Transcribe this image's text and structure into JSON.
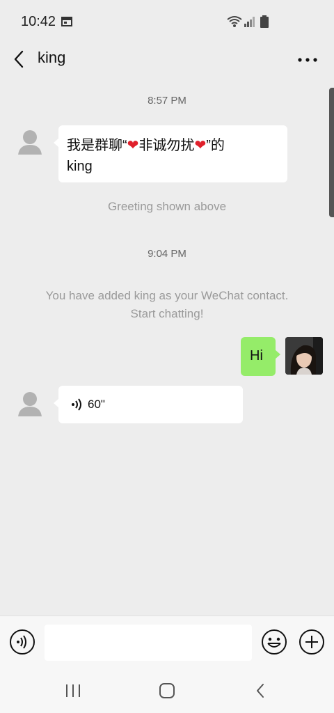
{
  "status_bar": {
    "time": "10:42"
  },
  "header": {
    "title": "king"
  },
  "chat": {
    "timestamp_1": "8:57 PM",
    "message_1": {
      "part1": "我是群聊“",
      "part2": "非诚勿扰",
      "part3": "”的",
      "line2": "king"
    },
    "greeting_note": "Greeting shown above",
    "timestamp_2": "9:04 PM",
    "contact_added_line1": "You have added king as your WeChat contact.",
    "contact_added_line2": "Start chatting!",
    "my_message": "Hi",
    "voice_message_duration": "60\""
  },
  "input_bar": {
    "placeholder": ""
  },
  "colors": {
    "background": "#ededed",
    "sent_bubble": "#95ec69",
    "received_bubble": "#ffffff",
    "heart": "#e0202b"
  }
}
